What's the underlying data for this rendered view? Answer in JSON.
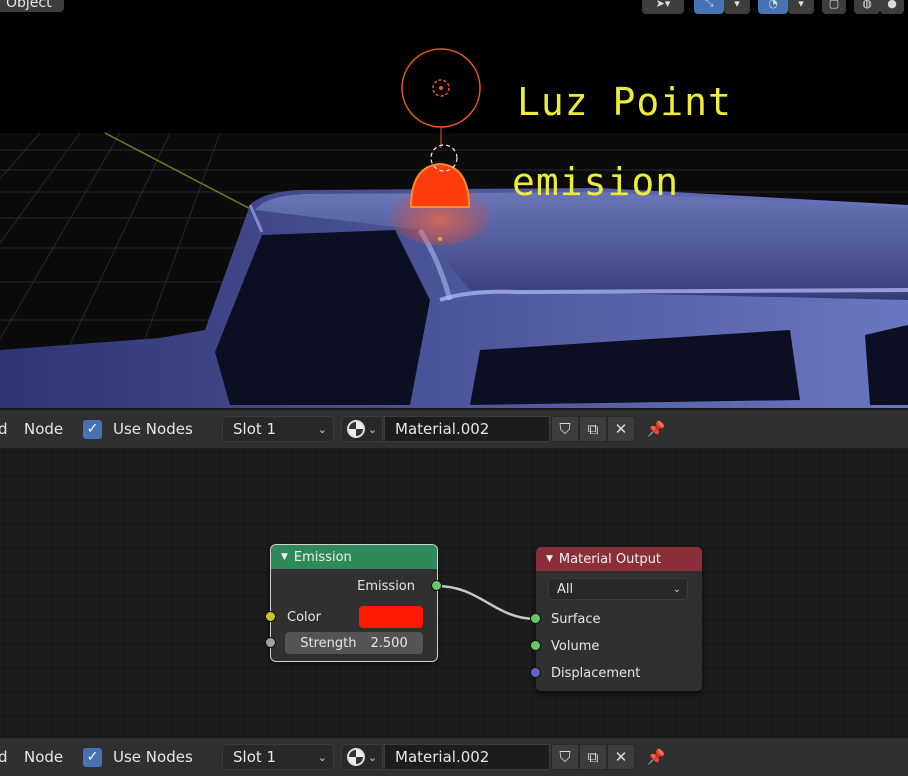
{
  "viewport": {
    "object_menu": "Object",
    "label_light": "Luz Point",
    "label_emission": "emision",
    "tool_icons": [
      "select-cursor-icon",
      "chevron-down-icon",
      "gizmo-icon",
      "chevron-down-icon",
      "overlay-icon",
      "chevron-down-icon",
      "xray-icon",
      "wireframe-shading-icon",
      "solid-shading-icon"
    ]
  },
  "node_header": {
    "fragment": "d",
    "node_menu": "Node",
    "use_nodes_checked": true,
    "use_nodes_label": "Use Nodes",
    "slot": "Slot 1",
    "material_name": "Material.002",
    "icons": [
      "material-browse-icon",
      "fake-user-shield-icon",
      "duplicate-icon",
      "close-icon",
      "pin-icon"
    ]
  },
  "nodes": {
    "emission": {
      "title": "Emission",
      "output_label": "Emission",
      "color_label": "Color",
      "color_value": "#ff1a05",
      "strength_label": "Strength",
      "strength_value": "2.500",
      "header_color": "#2e8a5a"
    },
    "material_output": {
      "title": "Material Output",
      "target": "All",
      "inputs": [
        "Surface",
        "Volume",
        "Displacement"
      ],
      "header_color": "#8a2f3a"
    }
  },
  "colors": {
    "accent": "#4772b3",
    "label_yellow": "#ecec3a",
    "light_orange": "#ff4a10"
  }
}
